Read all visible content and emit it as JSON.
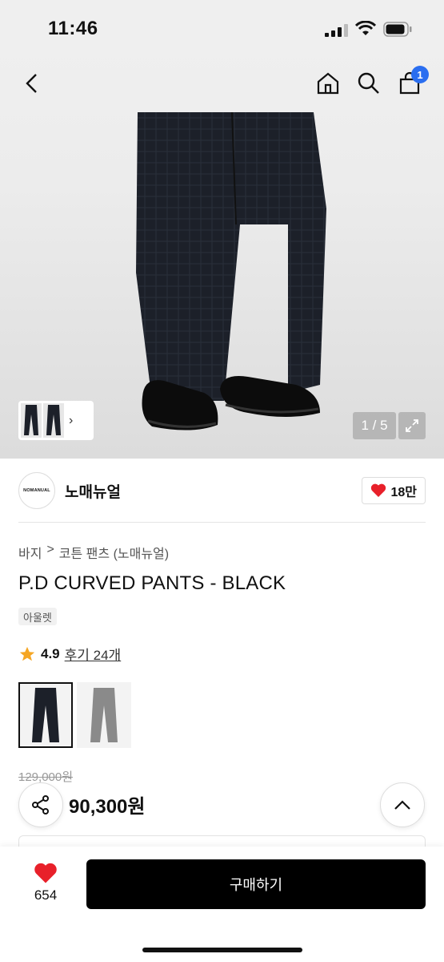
{
  "status_bar": {
    "time": "11:46"
  },
  "header": {
    "back_icon": "chevron-left-icon",
    "home_icon": "home-icon",
    "search_icon": "search-icon",
    "cart_icon": "shopping-bag-icon",
    "cart_badge": "1",
    "badge_color": "#2a6ef0"
  },
  "gallery": {
    "counter": "1 / 5",
    "expand_icon": "expand-icon",
    "thumbs_more_icon": "chevron-right-icon"
  },
  "brand": {
    "logo_text": "NOMANUAL",
    "name": "노매뉴얼",
    "likes": "18만",
    "heart_color": "#e8202a"
  },
  "breadcrumb": {
    "items": [
      "바지",
      "코튼 팬츠 (노매뉴얼)"
    ],
    "separator": ">"
  },
  "product": {
    "title": "P.D CURVED PANTS - BLACK",
    "tag": "아울렛",
    "rating": "4.9",
    "reviews": "후기 24개",
    "original_price": "129,000원",
    "price": "90,300원"
  },
  "colors": [
    {
      "name": "black",
      "selected": true
    },
    {
      "name": "gray",
      "selected": false
    }
  ],
  "bottom_bar": {
    "wish_count": "654",
    "buy_label": "구매하기"
  }
}
